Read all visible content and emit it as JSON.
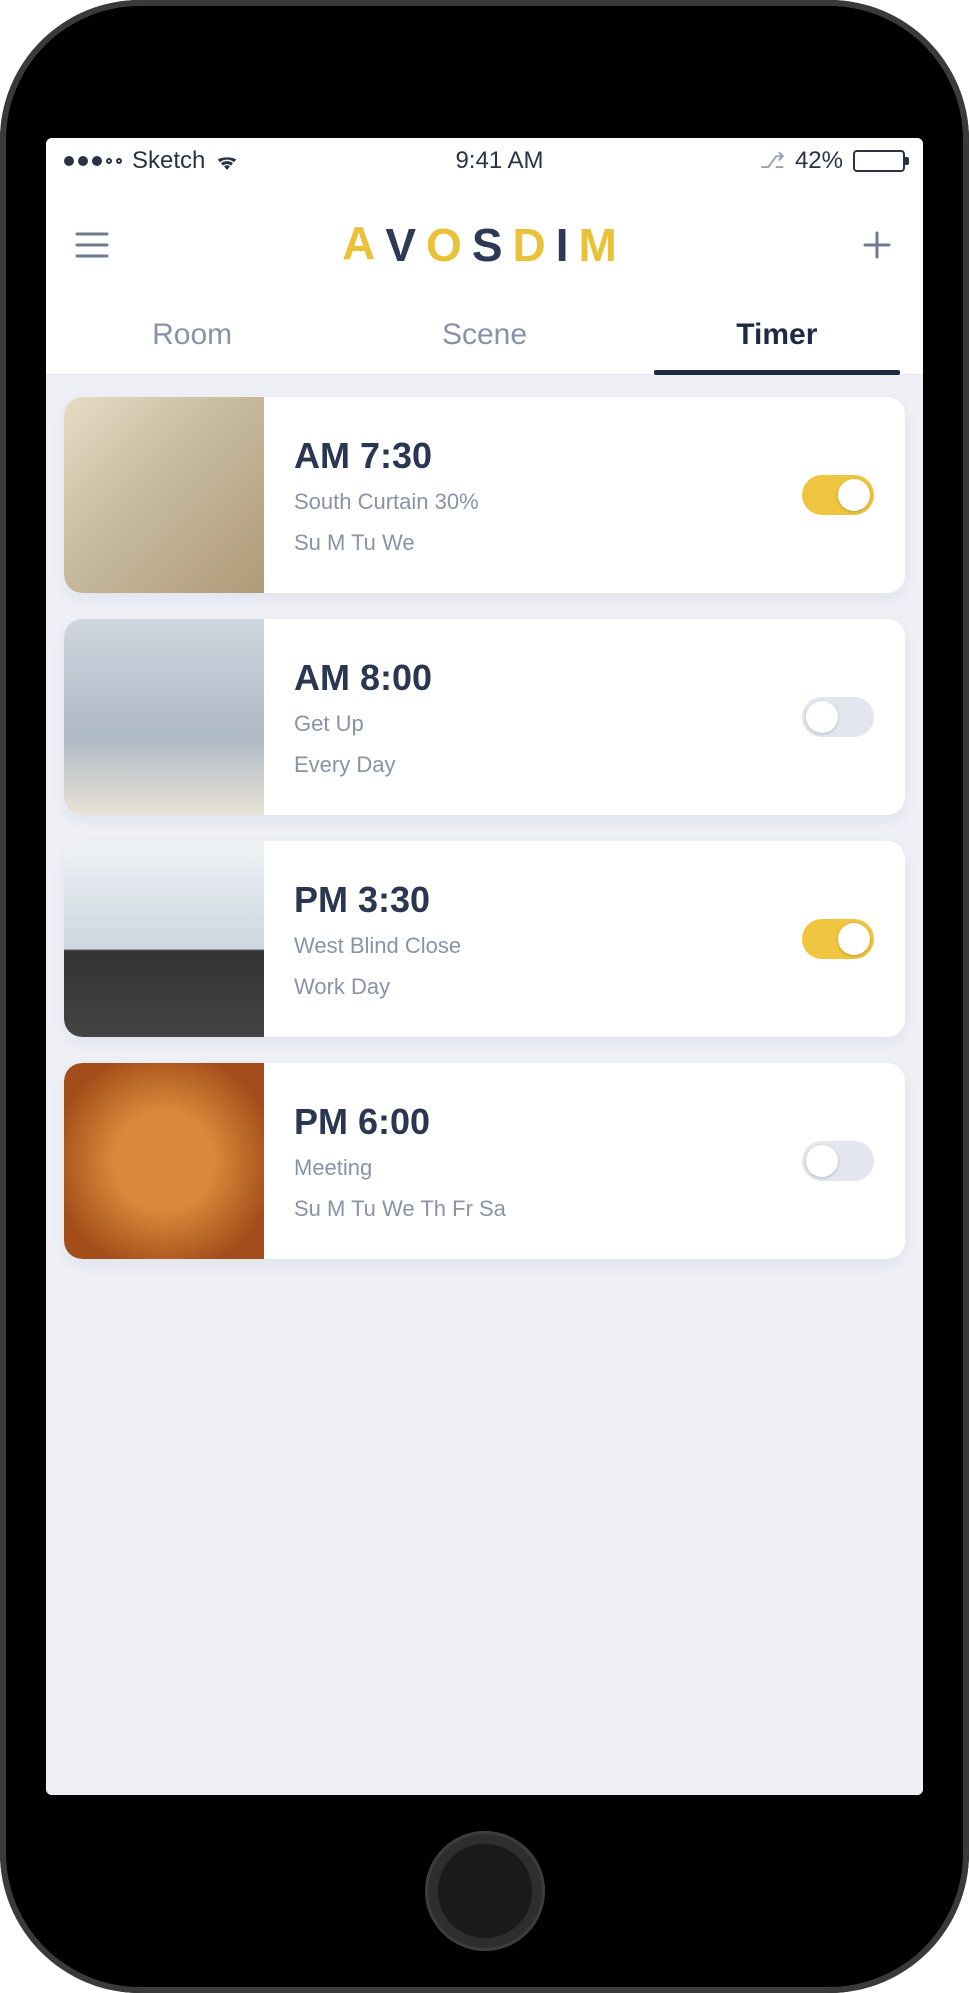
{
  "status_bar": {
    "carrier": "Sketch",
    "time": "9:41 AM",
    "battery_percent": "42%"
  },
  "header": {
    "logo_text": "AVOSDIM",
    "logo_colors": {
      "accent": "#e9c23a",
      "dark": "#2e3a55"
    }
  },
  "tabs": [
    {
      "label": "Room",
      "active": false
    },
    {
      "label": "Scene",
      "active": false
    },
    {
      "label": "Timer",
      "active": true
    }
  ],
  "timers": [
    {
      "time": "AM 7:30",
      "subtitle": "South Curtain  30%",
      "days": "Su M Tu We",
      "enabled": true,
      "thumb": "room1"
    },
    {
      "time": "AM 8:00",
      "subtitle": "Get Up",
      "days": "Every Day",
      "enabled": false,
      "thumb": "room2"
    },
    {
      "time": "PM 3:30",
      "subtitle": "West Blind  Close",
      "days": "Work Day",
      "enabled": true,
      "thumb": "room3"
    },
    {
      "time": "PM 6:00",
      "subtitle": "Meeting",
      "days": "Su M Tu We Th Fr Sa",
      "enabled": false,
      "thumb": "room4"
    }
  ]
}
